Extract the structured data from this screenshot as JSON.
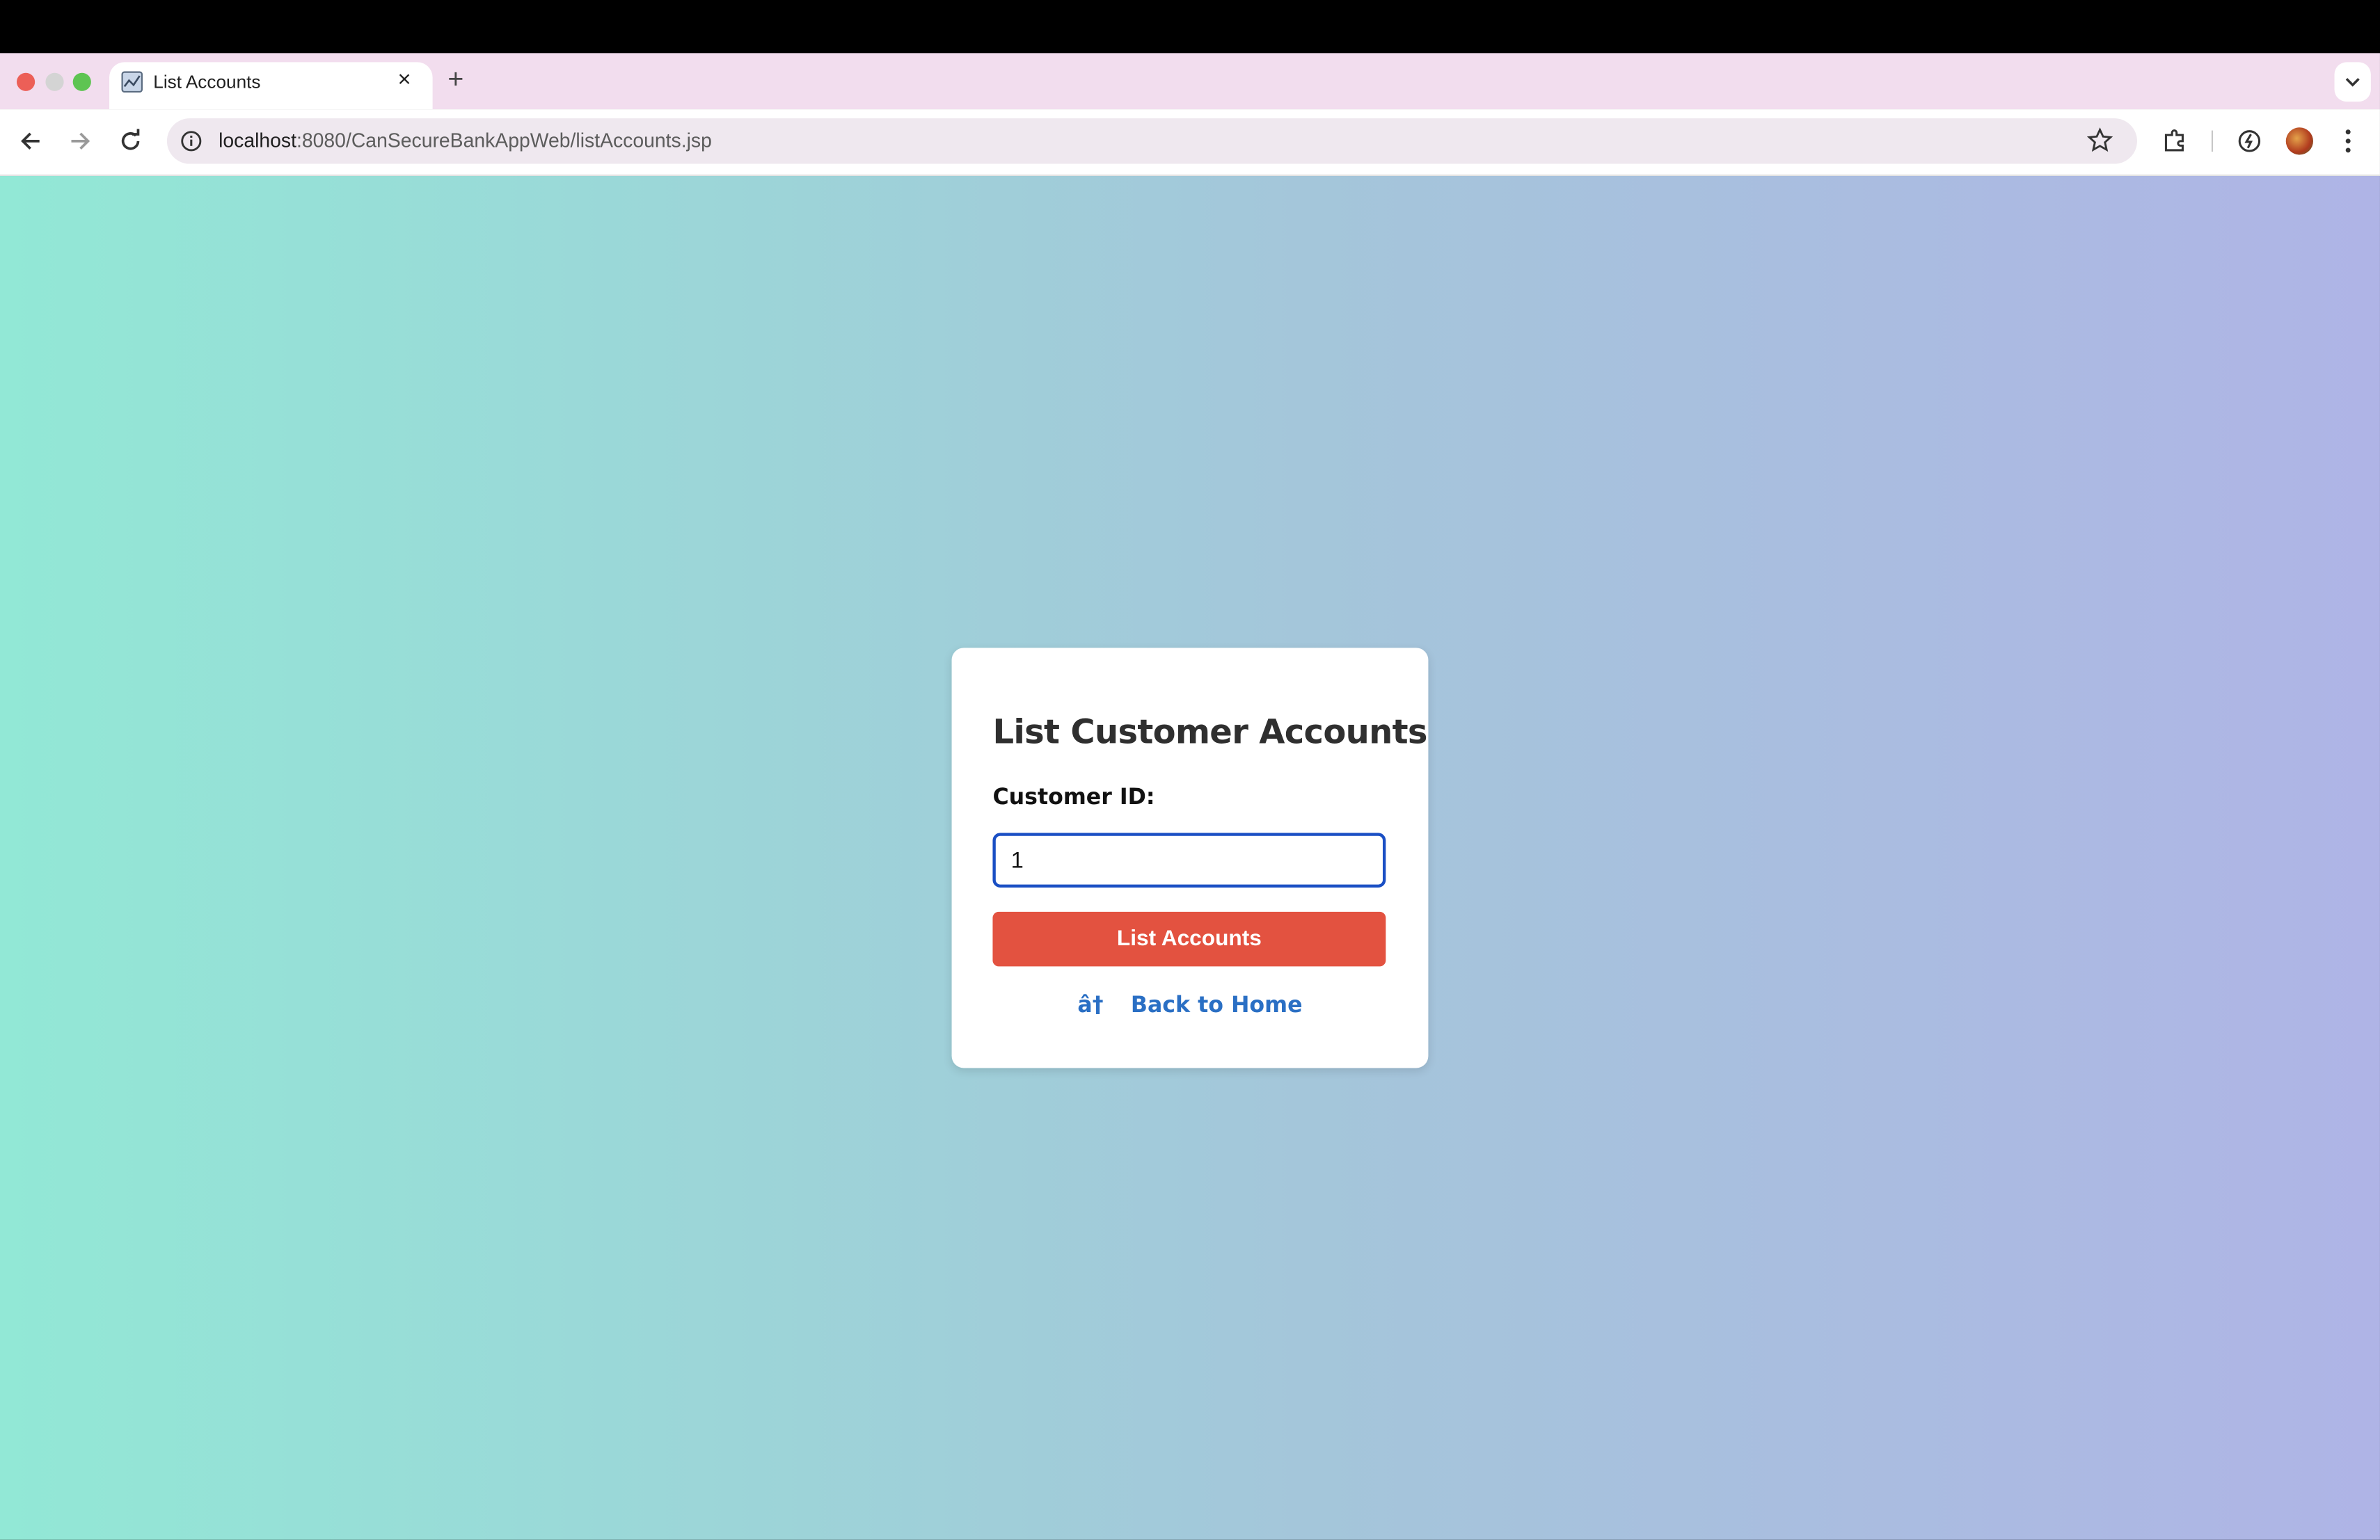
{
  "browser": {
    "tab_title": "List Accounts",
    "tab_close": "×",
    "new_tab": "+",
    "url_host": "localhost",
    "url_rest": ":8080/CanSecureBankAppWeb/listAccounts.jsp",
    "traffic_colors": [
      "#ec5f57",
      "#d4d4d4",
      "#5ec452"
    ]
  },
  "page": {
    "background_left": "#92e8d6",
    "background_right": "#afb4e6"
  },
  "form": {
    "title": "List Customer Accounts",
    "customer_id_label": "Customer ID:",
    "customer_id_value": "1",
    "submit_label": "List Accounts",
    "submit_color": "#e35240",
    "back_glyph": "â†",
    "back_label": "Back to Home",
    "link_color": "#2a6fc4"
  }
}
